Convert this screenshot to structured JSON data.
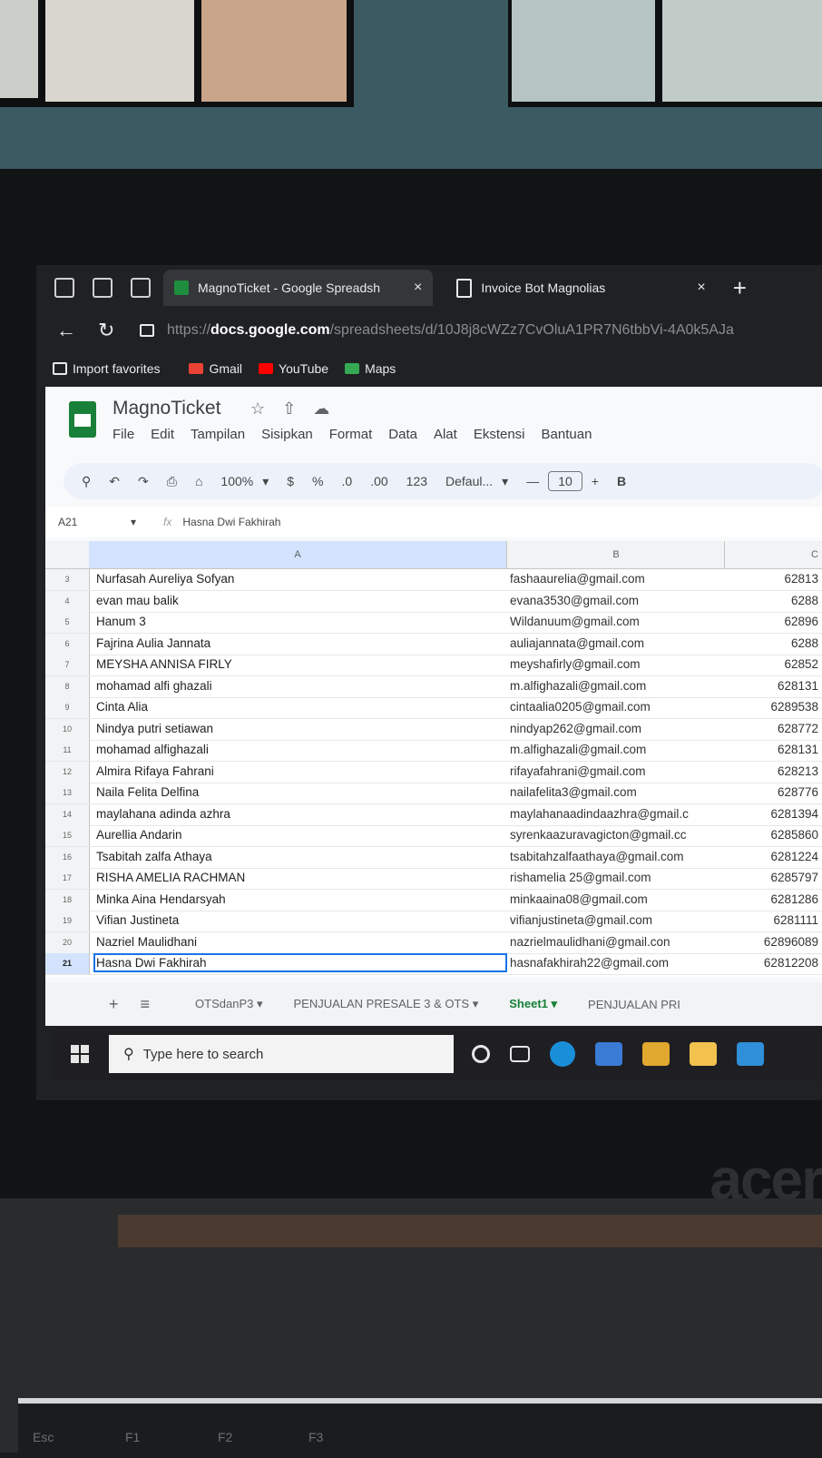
{
  "browser": {
    "tabs": [
      {
        "title": "MagnoTicket - Google Spreadsh",
        "active": true
      },
      {
        "title": "Invoice Bot Magnolias",
        "active": false
      }
    ],
    "close_glyph": "×",
    "newtab_glyph": "+",
    "url_scheme": "https://",
    "url_host": "docs.google.com",
    "url_path": "/spreadsheets/d/10J8j8cWZz7CvOluA1PR7N6tbbVi-4A0k5AJa",
    "bookmarks": [
      {
        "label": "Import favorites",
        "icon": "folder-icon"
      },
      {
        "label": "Gmail",
        "icon": "gmail-icon"
      },
      {
        "label": "YouTube",
        "icon": "youtube-icon"
      },
      {
        "label": "Maps",
        "icon": "maps-icon"
      }
    ]
  },
  "sheets": {
    "doc_name": "MagnoTicket",
    "menu": [
      "File",
      "Edit",
      "Tampilan",
      "Sisipkan",
      "Format",
      "Data",
      "Alat",
      "Ekstensi",
      "Bantuan"
    ],
    "toolbar": {
      "zoom": "100%",
      "currency": "$",
      "percent": "%",
      "dec_less": ".0",
      "dec_more": ".00",
      "num_format": "123",
      "font": "Defaul...",
      "font_size": "10",
      "minus": "—",
      "plus": "+",
      "bold": "B"
    },
    "name_box": "A21",
    "fx": "fx",
    "formula_value": "Hasna Dwi Fakhirah",
    "columns": [
      "A",
      "B",
      "C"
    ],
    "rows": [
      {
        "num": "3",
        "a": "Nurfasah Aureliya Sofyan",
        "b": "fashaaurelia@gmail.com",
        "c": "62813"
      },
      {
        "num": "4",
        "a": "evan mau balik",
        "b": "evana3530@gmail.com",
        "c": "6288"
      },
      {
        "num": "5",
        "a": "Hanum 3",
        "b": "Wildanuum@gmail.com",
        "c": "62896"
      },
      {
        "num": "6",
        "a": "Fajrina Aulia Jannata",
        "b": "auliajannata@gmail.com",
        "c": "6288"
      },
      {
        "num": "7",
        "a": "MEYSHA ANNISA FIRLY",
        "b": "meyshafirly@gmail.com",
        "c": "62852"
      },
      {
        "num": "8",
        "a": "mohamad alfi ghazali",
        "b": "m.alfighazali@gmail.com",
        "c": "628131"
      },
      {
        "num": "9",
        "a": "Cinta Alia",
        "b": "cintaalia0205@gmail.com",
        "c": "6289538"
      },
      {
        "num": "10",
        "a": "Nindya putri setiawan",
        "b": "nindyap262@gmail.com",
        "c": "628772"
      },
      {
        "num": "11",
        "a": "mohamad alfighazali",
        "b": "m.alfighazali@gmail.com",
        "c": "628131"
      },
      {
        "num": "12",
        "a": "Almira Rifaya Fahrani",
        "b": "rifayafahrani@gmail.com",
        "c": "628213"
      },
      {
        "num": "13",
        "a": "Naila Felita Delfina",
        "b": "nailafelita3@gmail.com",
        "c": "628776"
      },
      {
        "num": "14",
        "a": "maylahana adinda azhra",
        "b": "maylahanaadindaazhra@gmail.c",
        "c": "6281394"
      },
      {
        "num": "15",
        "a": "Aurellia Andarin",
        "b": "syrenkaazuravagicton@gmail.cc",
        "c": "6285860"
      },
      {
        "num": "16",
        "a": "Tsabitah zalfa Athaya",
        "b": "tsabitahzalfaathaya@gmail.com",
        "c": "6281224"
      },
      {
        "num": "17",
        "a": "RISHA AMELIA RACHMAN",
        "b": "rishamelia 25@gmail.com",
        "c": "6285797"
      },
      {
        "num": "18",
        "a": "Minka Aina Hendarsyah",
        "b": "minkaaina08@gmail.com",
        "c": "6281286"
      },
      {
        "num": "19",
        "a": "Vifian Justineta",
        "b": "vifianjustineta@gmail.com",
        "c": "6281111"
      },
      {
        "num": "20",
        "a": "Nazriel Maulidhani",
        "b": "nazrielmaulidhani@gmail.con",
        "c": "62896089"
      },
      {
        "num": "21",
        "a": "Hasna Dwi Fakhirah",
        "b": "hasnafakhirah22@gmail.com",
        "c": "62812208"
      }
    ],
    "sheet_tabs": [
      {
        "label": "OTSdanP3 ▾",
        "active": false
      },
      {
        "label": "PENJUALAN PRESALE 3 & OTS ▾",
        "active": false
      },
      {
        "label": "Sheet1 ▾",
        "active": true
      },
      {
        "label": "PENJUALAN PRI",
        "active": false
      }
    ],
    "add_sheet": "+",
    "all_sheets": "≡"
  },
  "taskbar": {
    "search_placeholder": "Type here to search"
  },
  "laptop": {
    "brand": "acer",
    "keys": [
      "Esc",
      "F1",
      "F2",
      "F3"
    ]
  }
}
